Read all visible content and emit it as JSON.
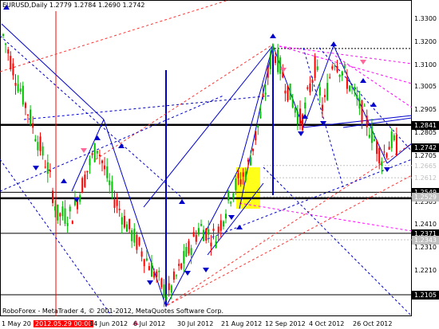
{
  "header": {
    "symbol": "EURUSD,Daily",
    "ohlc": "1.2779 1.2784 1.2690 1.2742"
  },
  "footer": {
    "copyright": "RoboForex - MetaTrader 4, © 2001-2012, MetaQuotes Software Corp."
  },
  "price_axis": {
    "ticks": [
      "1.3300",
      "1.3200",
      "1.3100",
      "1.3005",
      "1.2905",
      "1.2805",
      "1.2705",
      "1.2605",
      "1.2505",
      "1.2410",
      "1.2310",
      "1.2210",
      "1.2105"
    ],
    "tags": [
      {
        "text": "1.2841",
        "bg": "#000000",
        "fg": "#ffffff"
      },
      {
        "text": "1.2742",
        "bg": "#000000",
        "fg": "#ffffff"
      },
      {
        "text": "1.2665",
        "bg": "#ffffff",
        "fg": "#c0c0c0"
      },
      {
        "text": "1.2612",
        "bg": "#ffffff",
        "fg": "#c0c0c0"
      },
      {
        "text": "1.2549",
        "bg": "#000000",
        "fg": "#ffffff"
      },
      {
        "text": "1.2529",
        "bg": "#c0c0c0",
        "fg": "#ffffff"
      },
      {
        "text": "1.2371",
        "bg": "#000000",
        "fg": "#ffffff"
      },
      {
        "text": "1.2343",
        "bg": "#c0c0c0",
        "fg": "#ffffff"
      },
      {
        "text": "1.2105",
        "bg": "#000000",
        "fg": "#ffffff"
      }
    ]
  },
  "time_axis": {
    "labels": [
      "1 May 20",
      "2012.05.29 00:00",
      "14 Jun 2012",
      "6 Jul 2012",
      "30 Jul 2012",
      "21 Aug 2012",
      "12 Sep 2012",
      "4 Oct 2012",
      "26 Oct 2012"
    ],
    "cursor_label": "2012.05.29 00:00"
  },
  "colors": {
    "bull": "#00c000",
    "bear": "#ff0000",
    "wave": "#0000cc",
    "fib": "#ff0066",
    "magenta": "#ff00ff",
    "highlight": "#ffff00"
  },
  "chart_data": {
    "type": "candlestick",
    "symbol": "EURUSD",
    "timeframe": "Daily",
    "last_bar": {
      "open": 1.2779,
      "high": 1.2784,
      "low": 1.269,
      "close": 1.2742
    },
    "ylim": [
      1.206,
      1.332
    ],
    "horizontal_levels": [
      1.2841,
      1.2549,
      1.2371,
      1.2105
    ],
    "marked_levels": [
      1.2665,
      1.2612,
      1.2529,
      1.2343
    ],
    "swing_points": [
      {
        "label": "start high",
        "value": 1.328
      },
      {
        "label": "low Jul",
        "value": 1.2045
      },
      {
        "label": "high Sep",
        "value": 1.3172
      },
      {
        "label": "high Oct",
        "value": 1.314
      },
      {
        "label": "recent low",
        "value": 1.268
      }
    ]
  }
}
